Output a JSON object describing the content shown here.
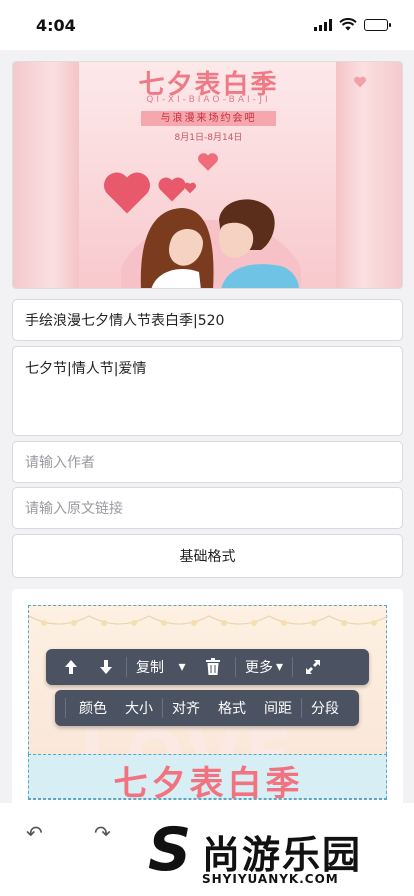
{
  "status": {
    "time": "4:04"
  },
  "cover": {
    "title": "七夕表白季",
    "pinyin": "QI-XI-BIAO-BAI-JI",
    "tag": "与浪漫来场约会吧",
    "date": "8月1日-8月14日"
  },
  "form": {
    "title_value": "手绘浪漫七夕情人节表白季|520",
    "tags_value": "七夕节|情人节|爱情",
    "author_placeholder": "请输入作者",
    "link_placeholder": "请输入原文链接",
    "basic_format_label": "基础格式"
  },
  "editor": {
    "bg_word": "LOVE",
    "band_title": "七夕表白季",
    "toolbar_main": {
      "copy_label": "复制",
      "more_label": "更多"
    },
    "toolbar_format": [
      "颜色",
      "大小",
      "对齐",
      "格式",
      "间距",
      "分段"
    ]
  },
  "watermark": {
    "name": "尚游乐园",
    "domain": "SHYIYUANYK.COM"
  }
}
